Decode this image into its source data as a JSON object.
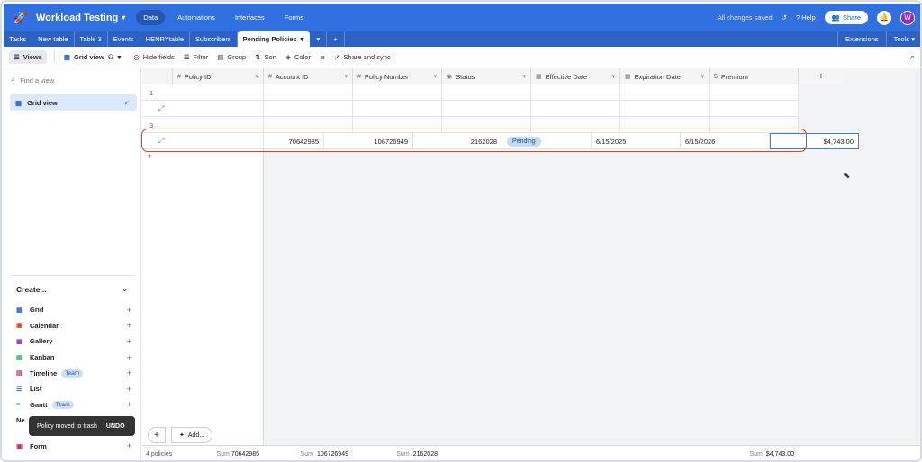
{
  "topbar": {
    "base_title": "Workload Testing",
    "nav": [
      "Data",
      "Automations",
      "Interfaces",
      "Forms"
    ],
    "active_nav": "Data",
    "saved_status": "All changes saved",
    "help": "Help",
    "share": "Share",
    "avatar_initial": "W",
    "brand_color": "#3170e0"
  },
  "tabs": {
    "items": [
      "Tasks",
      "New table",
      "Table 3",
      "Events",
      "HENRYtable",
      "Subscribers"
    ],
    "active": "Pending Policies",
    "extensions": "Extensions",
    "tools": "Tools"
  },
  "toolbar": {
    "views": "Views",
    "grid_view": "Grid view",
    "hide_fields": "Hide fields",
    "filter": "Filter",
    "group": "Group",
    "sort": "Sort",
    "color": "Color",
    "share_sync": "Share and sync"
  },
  "sidebar": {
    "find_placeholder": "Find a view",
    "active_view": "Grid view",
    "create_label": "Create...",
    "create_items": [
      {
        "icon": "grid-icon",
        "label": "Grid",
        "badge": ""
      },
      {
        "icon": "calendar-icon",
        "label": "Calendar",
        "badge": ""
      },
      {
        "icon": "gallery-icon",
        "label": "Gallery",
        "badge": ""
      },
      {
        "icon": "kanban-icon",
        "label": "Kanban",
        "badge": ""
      },
      {
        "icon": "timeline-icon",
        "label": "Timeline",
        "badge": "Team"
      },
      {
        "icon": "list-icon",
        "label": "List",
        "badge": ""
      },
      {
        "icon": "gantt-icon",
        "label": "Gantt",
        "badge": "Team"
      }
    ],
    "new_label": "Ne",
    "form_label": "Form",
    "toast": "Policy moved to trash",
    "toast_action": "UNDO"
  },
  "grid": {
    "columns": [
      "Policy ID",
      "Account ID",
      "Policy Number",
      "Status",
      "Effective Date",
      "Expiration Date",
      "Premium"
    ],
    "row_numbers": [
      "1",
      "",
      "3",
      ""
    ],
    "record": {
      "policy_id": "70642985",
      "account_id": "106726949",
      "policy_number": "2162028",
      "status": "Pending",
      "effective_date": "6/15/2025",
      "expiration_date": "6/15/2026",
      "premium": "$4,743.00"
    },
    "add_label": "Add...",
    "footer": {
      "count": "4 policies",
      "sum_label": "Sum",
      "sum_policy_id": "70642985",
      "sum_account_id": "106726949",
      "sum_policy_number": "2162028",
      "sum_premium": "$4,743.00"
    }
  }
}
